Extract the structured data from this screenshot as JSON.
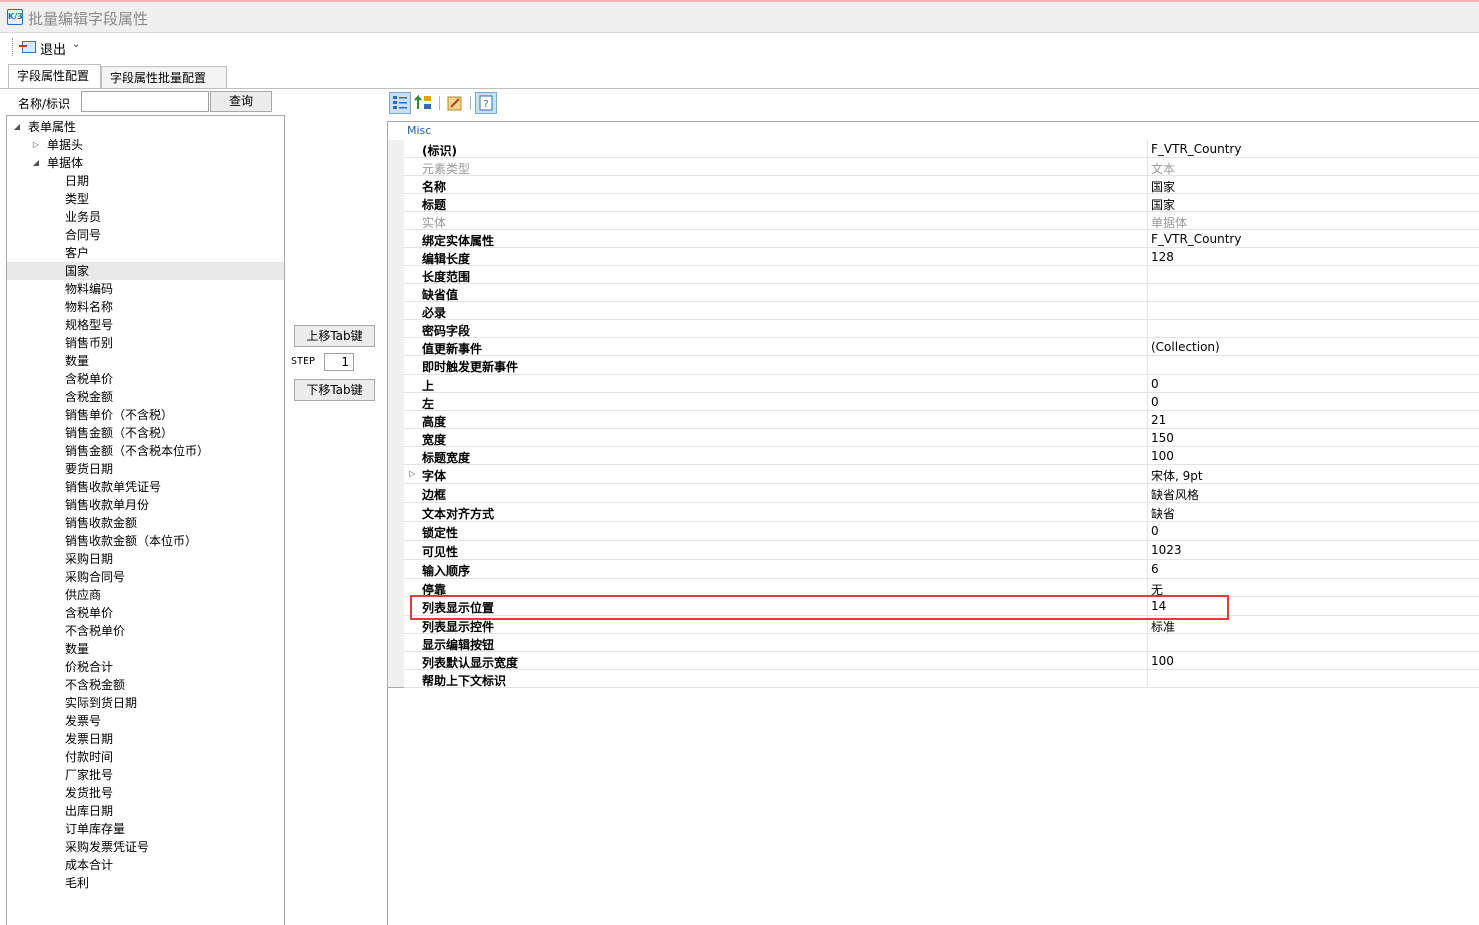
{
  "window": {
    "title": "批量编辑字段属性",
    "app_icon": "K/3"
  },
  "toolbar": {
    "exit_label": "退出"
  },
  "tabs": [
    {
      "label": "字段属性配置",
      "active": true
    },
    {
      "label": "字段属性批量配置",
      "active": false
    }
  ],
  "search": {
    "label": "名称/标识",
    "value": "",
    "button_label": "查询"
  },
  "tree": {
    "root": "表单属性",
    "groups": [
      {
        "label": "单据头",
        "expanded": false
      },
      {
        "label": "单据体",
        "expanded": true
      }
    ],
    "items": [
      "日期",
      "类型",
      "业务员",
      "合同号",
      "客户",
      "国家",
      "物料编码",
      "物料名称",
      "规格型号",
      "销售币别",
      "数量",
      "含税单价",
      "含税金额",
      "销售单价（不含税）",
      "销售金额（不含税）",
      "销售金额（不含税本位币）",
      "要货日期",
      "销售收款单凭证号",
      "销售收款单月份",
      "销售收款金额",
      "销售收款金额（本位币）",
      "采购日期",
      "采购合同号",
      "供应商",
      "含税单价",
      "不含税单价",
      "数量",
      "价税合计",
      "不含税金额",
      "实际到货日期",
      "发票号",
      "发票日期",
      "付款时间",
      "厂家批号",
      "发货批号",
      "出库日期",
      "订单库存量",
      "采购发票凭证号",
      "成本合计",
      "毛利"
    ],
    "selected": "国家"
  },
  "tab_order": {
    "up_label": "上移Tab键",
    "down_label": "下移Tab键",
    "step_label": "STEP",
    "step_value": "1"
  },
  "property_grid": {
    "category": "Misc",
    "rows": [
      {
        "name": "(标识)",
        "value": "F_VTR_Country"
      },
      {
        "name": "元素类型",
        "value": "文本",
        "readonly": true
      },
      {
        "name": "名称",
        "value": "国家"
      },
      {
        "name": "标题",
        "value": "国家"
      },
      {
        "name": "实体",
        "value": "单据体",
        "readonly": true
      },
      {
        "name": "绑定实体属性",
        "value": "F_VTR_Country"
      },
      {
        "name": "编辑长度",
        "value": "128"
      },
      {
        "name": "长度范围",
        "value": ""
      },
      {
        "name": "缺省值",
        "value": ""
      },
      {
        "name": "必录",
        "value": ""
      },
      {
        "name": "密码字段",
        "value": ""
      },
      {
        "name": "值更新事件",
        "value": "(Collection)"
      },
      {
        "name": "即时触发更新事件",
        "value": ""
      },
      {
        "name": "上",
        "value": "0"
      },
      {
        "name": "左",
        "value": "0"
      },
      {
        "name": "高度",
        "value": "21"
      },
      {
        "name": "宽度",
        "value": "150"
      },
      {
        "name": "标题宽度",
        "value": "100"
      },
      {
        "name": "字体",
        "value": "宋体, 9pt",
        "expandable": true
      },
      {
        "name": "边框",
        "value": "缺省风格"
      },
      {
        "name": "文本对齐方式",
        "value": "缺省"
      },
      {
        "name": "锁定性",
        "value": "0"
      },
      {
        "name": "可见性",
        "value": "1023"
      },
      {
        "name": "输入顺序",
        "value": "6"
      },
      {
        "name": "停靠",
        "value": "无"
      },
      {
        "name": "列表显示位置",
        "value": "14",
        "highlighted": true
      },
      {
        "name": "列表显示控件",
        "value": "标准"
      },
      {
        "name": "显示编辑按钮",
        "value": ""
      },
      {
        "name": "列表默认显示宽度",
        "value": "100"
      },
      {
        "name": "帮助上下文标识",
        "value": ""
      }
    ]
  },
  "colors": {
    "highlight_border": "#e03c3c",
    "category_text": "#1d5fa8",
    "selected_row": "#e8e8e8"
  }
}
